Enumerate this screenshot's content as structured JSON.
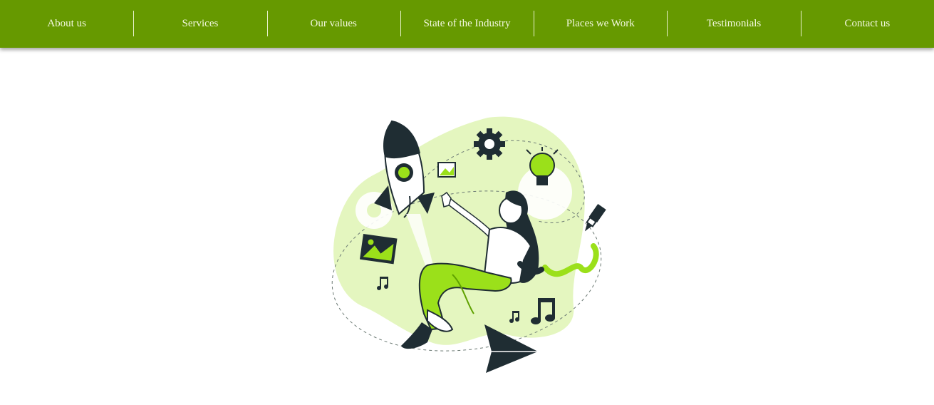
{
  "nav": {
    "items": [
      {
        "label": "About us"
      },
      {
        "label": "Services"
      },
      {
        "label": "Our values"
      },
      {
        "label": "State of the Industry"
      },
      {
        "label": "Places we Work"
      },
      {
        "label": "Testimonials"
      },
      {
        "label": "Contact us"
      }
    ]
  },
  "colors": {
    "nav_bg": "#669900",
    "nav_text": "#f4f9e0",
    "accent": "#9be01a",
    "blob": "#e4f6bf",
    "ink": "#1f2d33"
  },
  "hero": {
    "illustration": "woman-floating-with-rocket-illustration"
  }
}
